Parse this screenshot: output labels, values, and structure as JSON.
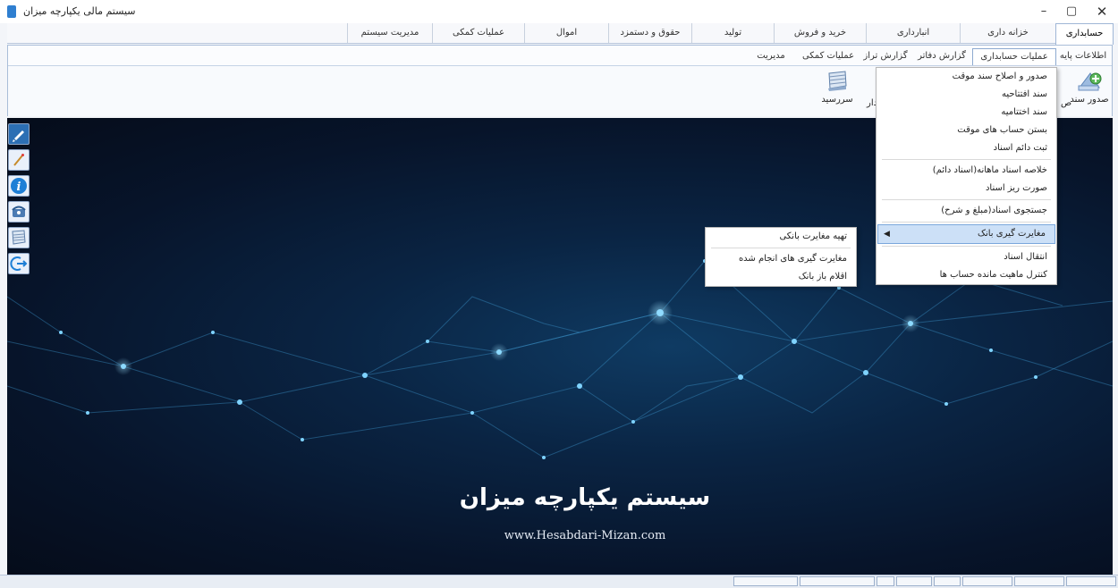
{
  "window": {
    "title": "سیستم مالی یکپارچه میزان",
    "minimize": "–",
    "maximize": "▢",
    "close": "✕"
  },
  "main_menu": [
    {
      "label": "حسابداری",
      "active": true
    },
    {
      "label": "خزانه داری"
    },
    {
      "label": "انبارداری"
    },
    {
      "label": "خرید و فروش"
    },
    {
      "label": "تولید"
    },
    {
      "label": "حقوق و دستمزد"
    },
    {
      "label": "اموال"
    },
    {
      "label": "عملیات کمکی"
    },
    {
      "label": "مدیریت سیستم"
    }
  ],
  "ribbon": {
    "tabs": [
      {
        "label": "اطلاعات پایه"
      },
      {
        "label": "عملیات حسابداری",
        "active": true
      },
      {
        "label": "گزارش دفاتر"
      },
      {
        "label": "گزارش تراز"
      },
      {
        "label": "عملیات کمکی"
      },
      {
        "label": "مدیریت"
      }
    ],
    "buttons": [
      {
        "label": "صدور سند",
        "icon": "document-add-icon"
      },
      {
        "label": "سررسید",
        "icon": "calendar-book-icon"
      }
    ],
    "clipped_text_1": "ص",
    "clipped_text_2": "دار"
  },
  "dropdown_main": {
    "items": [
      {
        "label": "صدور و اصلاح سند موقت"
      },
      {
        "label": "سند افتتاحیه"
      },
      {
        "label": "سند اختتامیه"
      },
      {
        "label": "بستن حساب های موقت"
      },
      {
        "label": "ثبت دائم اسناد"
      },
      {
        "separator": true
      },
      {
        "label": "خلاصه اسناد ماهانه(اسناد دائم)"
      },
      {
        "label": "صورت ریز اسناد"
      },
      {
        "separator": true
      },
      {
        "label": "جستجوی اسناد(مبلغ و شرح)"
      },
      {
        "separator": true
      },
      {
        "label": "مغایرت گیری بانک",
        "highlighted": true,
        "has_submenu": true
      },
      {
        "separator": true
      },
      {
        "label": "انتقال اسناد"
      },
      {
        "label": "کنترل ماهیت مانده حساب ها"
      }
    ]
  },
  "dropdown_sub": {
    "items": [
      {
        "label": "تهیه مغایرت بانکی"
      },
      {
        "separator": true
      },
      {
        "label": "مغایرت گیری های انجام شده"
      },
      {
        "label": "اقلام باز بانک"
      }
    ]
  },
  "left_toolbar": [
    {
      "icon": "edit-icon"
    },
    {
      "icon": "pencil-icon"
    },
    {
      "icon": "info-icon"
    },
    {
      "icon": "phone-icon"
    },
    {
      "icon": "notebook-icon"
    },
    {
      "icon": "logout-icon"
    }
  ],
  "hero": {
    "title": "سیستم یکپارچه میزان",
    "url": "www.Hesabdari-Mizan.com"
  },
  "colors": {
    "accent": "#2f7fd0",
    "menu_highlight": "#cce0f7",
    "hero_dark": "#07142a"
  }
}
